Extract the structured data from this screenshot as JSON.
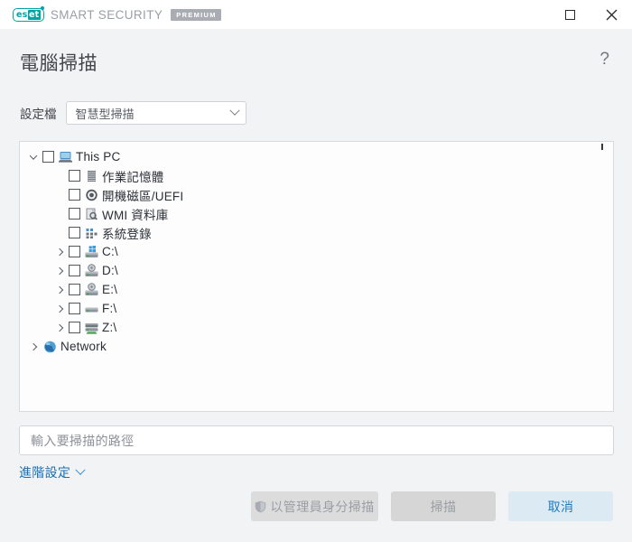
{
  "window": {
    "brand_name": "SMART SECURITY",
    "brand_logo_text_a": "es",
    "brand_logo_text_b": "et",
    "edition_badge": "PREMIUM",
    "maximize_label": "Maximize",
    "close_label": "Close"
  },
  "header": {
    "title": "電腦掃描",
    "help_label": "?"
  },
  "profile": {
    "label": "設定檔",
    "selected": "智慧型掃描",
    "options": [
      "智慧型掃描"
    ]
  },
  "tree": {
    "nodes": [
      {
        "label": "This PC",
        "icon": "computer-icon",
        "level": 0,
        "expander": "down",
        "checkbox": true,
        "checked": false
      },
      {
        "label": "作業記憶體",
        "icon": "memory-icon",
        "level": 1,
        "expander": "none",
        "checkbox": true,
        "checked": false
      },
      {
        "label": "開機磁區/UEFI",
        "icon": "boot-disc-icon",
        "level": 1,
        "expander": "none",
        "checkbox": true,
        "checked": false
      },
      {
        "label": "WMI 資料庫",
        "icon": "wmi-icon",
        "level": 1,
        "expander": "none",
        "checkbox": true,
        "checked": false
      },
      {
        "label": "系統登錄",
        "icon": "registry-icon",
        "level": 1,
        "expander": "none",
        "checkbox": true,
        "checked": false
      },
      {
        "label": "C:\\",
        "icon": "windows-drive-icon",
        "level": 1,
        "expander": "right",
        "checkbox": true,
        "checked": false
      },
      {
        "label": "D:\\",
        "icon": "optical-drive-icon",
        "level": 1,
        "expander": "right",
        "checkbox": true,
        "checked": false
      },
      {
        "label": "E:\\",
        "icon": "optical-drive-icon",
        "level": 1,
        "expander": "right",
        "checkbox": true,
        "checked": false
      },
      {
        "label": "F:\\",
        "icon": "drive-icon",
        "level": 1,
        "expander": "right",
        "checkbox": true,
        "checked": false
      },
      {
        "label": "Z:\\",
        "icon": "network-drive-icon",
        "level": 1,
        "expander": "right",
        "checkbox": true,
        "checked": false
      },
      {
        "label": "Network",
        "icon": "globe-icon",
        "level": 0,
        "expander": "right",
        "checkbox": false,
        "checked": false
      }
    ]
  },
  "path_field": {
    "placeholder": "輸入要掃描的路徑",
    "value": ""
  },
  "advanced": {
    "label": "進階設定"
  },
  "footer": {
    "admin_scan_label": "以管理員身分掃描",
    "admin_scan_enabled": false,
    "scan_label": "掃描",
    "scan_enabled": false,
    "cancel_label": "取消",
    "cancel_enabled": true
  },
  "colors": {
    "brand_teal": "#00a3a6",
    "accent_blue": "#1f7cc0",
    "link_blue": "#1a6fb5",
    "page_bg": "#f2f3f5",
    "titlebar_bg": "#ffffff",
    "panel_bg": "#fdfdfd",
    "disabled_text": "#9a9ea4"
  }
}
